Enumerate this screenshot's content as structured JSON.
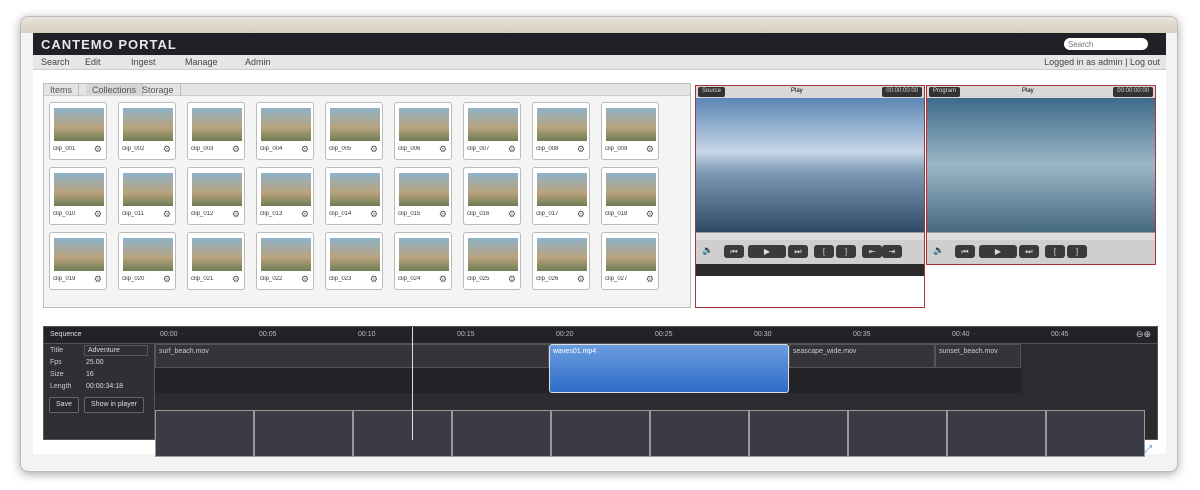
{
  "app": {
    "logo": "CANTEMO PORTAL",
    "search_placeholder": "Search"
  },
  "menu": {
    "items": [
      "Search",
      "Edit",
      "Ingest",
      "Manage",
      "Admin"
    ],
    "user": "Logged in as admin | Log out"
  },
  "library": {
    "tabs": [
      "Items",
      "Collections",
      "Storage"
    ],
    "items": [
      "clip_001",
      "clip_002",
      "clip_003",
      "clip_004",
      "clip_005",
      "clip_006",
      "clip_007",
      "clip_008",
      "clip_009",
      "clip_010",
      "clip_011",
      "clip_012",
      "clip_013",
      "clip_014",
      "clip_015",
      "clip_016",
      "clip_017",
      "clip_018",
      "clip_019",
      "clip_020",
      "clip_021",
      "clip_022",
      "clip_023",
      "clip_024",
      "clip_025",
      "clip_026",
      "clip_027"
    ]
  },
  "player1": {
    "left_label": "Source",
    "center_label": "Play",
    "right_label": "00:00:00:00"
  },
  "player2": {
    "left_label": "Program",
    "center_label": "Play",
    "right_label": "00:00:00:00"
  },
  "timeline": {
    "title": "Sequence",
    "ticks": [
      "00:00",
      "00:05",
      "00:10",
      "00:15",
      "00:20",
      "00:25",
      "00:30",
      "00:35",
      "00:40",
      "00:45"
    ],
    "info": [
      {
        "label": "Title",
        "value": "Adventure"
      },
      {
        "label": "Fps",
        "value": "25.00"
      },
      {
        "label": "Size",
        "value": "16"
      },
      {
        "label": "Length",
        "value": "00:00:34:18"
      }
    ],
    "buttons": [
      "Save",
      "Show in player"
    ],
    "clips": [
      "surf_beach.mov",
      "waves01.mp4",
      "seascape_wide.mov",
      "sunset_beach.mov"
    ]
  }
}
